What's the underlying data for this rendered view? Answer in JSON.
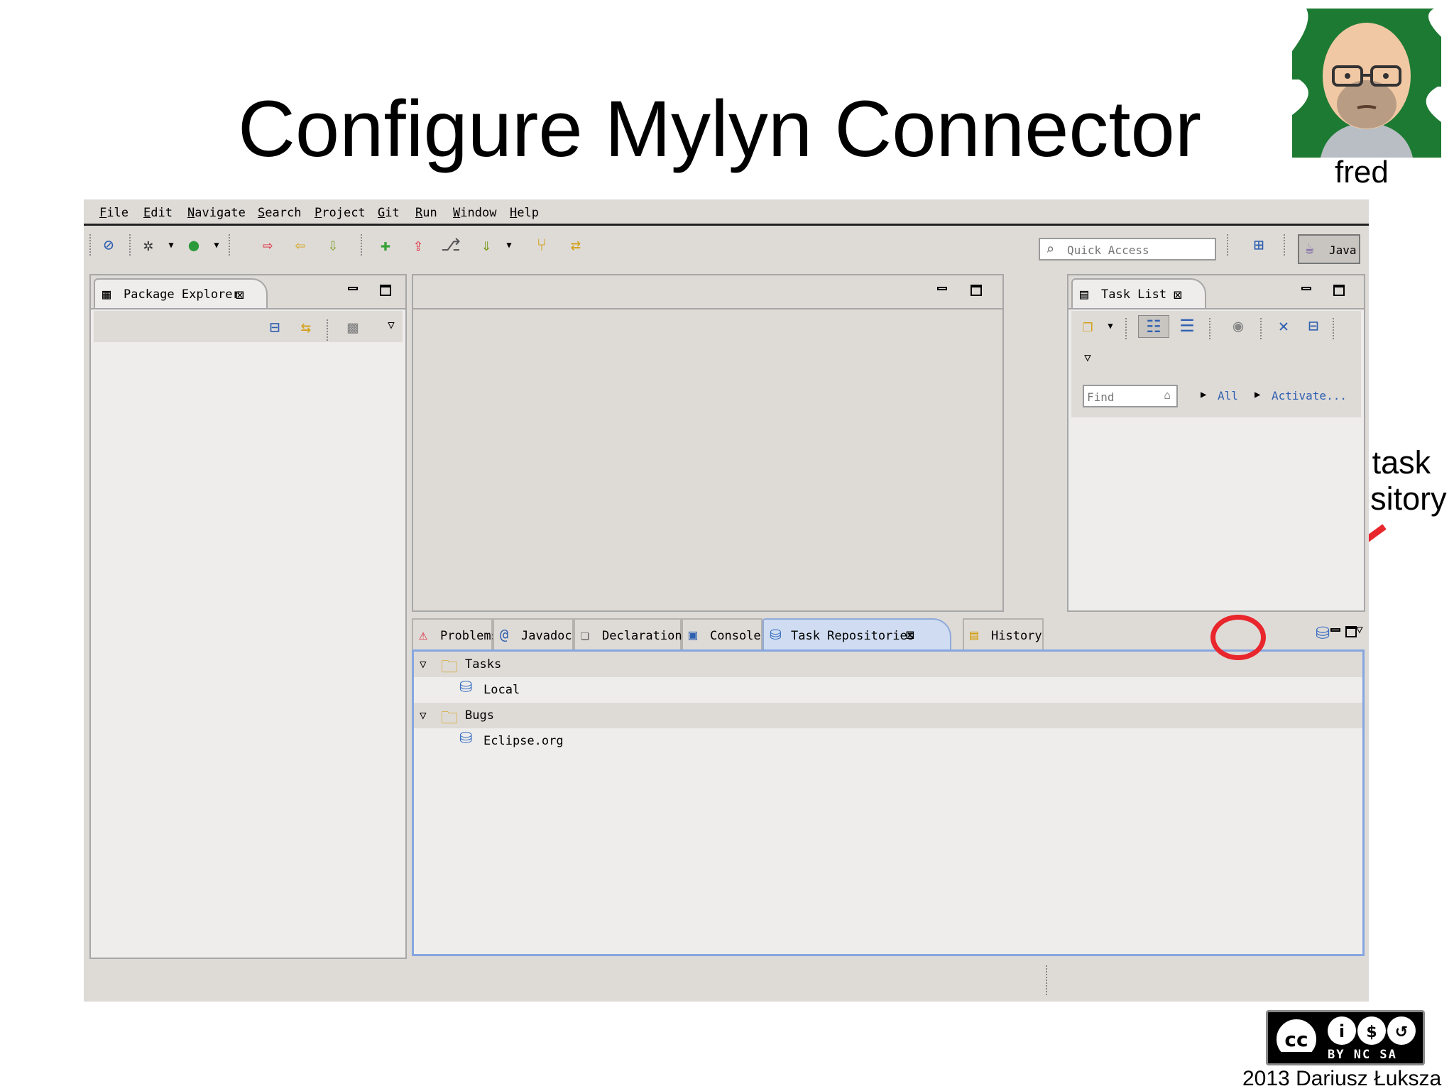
{
  "slide": {
    "title": "Configure Mylyn Connector",
    "avatar_name": "fred",
    "annotation_line1": "Add task",
    "annotation_line2": "repository",
    "credit": "2013 Dariusz Łuksza",
    "license_badge": "BY NC SA",
    "highlight_color": "#e8262c"
  },
  "menubar": {
    "items": [
      "File",
      "Edit",
      "Navigate",
      "Search",
      "Project",
      "Git",
      "Run",
      "Window",
      "Help"
    ]
  },
  "toolbar": {
    "quick_access_placeholder": "Quick Access",
    "perspective_label": "Java"
  },
  "package_explorer": {
    "tab_label": "Package Explorer"
  },
  "task_list": {
    "tab_label": "Task List",
    "find_placeholder": "Find",
    "filter_all": "All",
    "activate_link": "Activate..."
  },
  "bottom_panel": {
    "tabs": [
      "Problems",
      "Javadoc",
      "Declaration",
      "Console",
      "Task Repositories",
      "History"
    ],
    "active_tab": "Task Repositories"
  },
  "task_repositories": {
    "groups": [
      {
        "label": "Tasks",
        "items": [
          "Local"
        ]
      },
      {
        "label": "Bugs",
        "items": [
          "Eclipse.org"
        ]
      }
    ]
  },
  "icons": {
    "accent": "#86a6df",
    "active_tab_bg": "#cfdcf1"
  }
}
